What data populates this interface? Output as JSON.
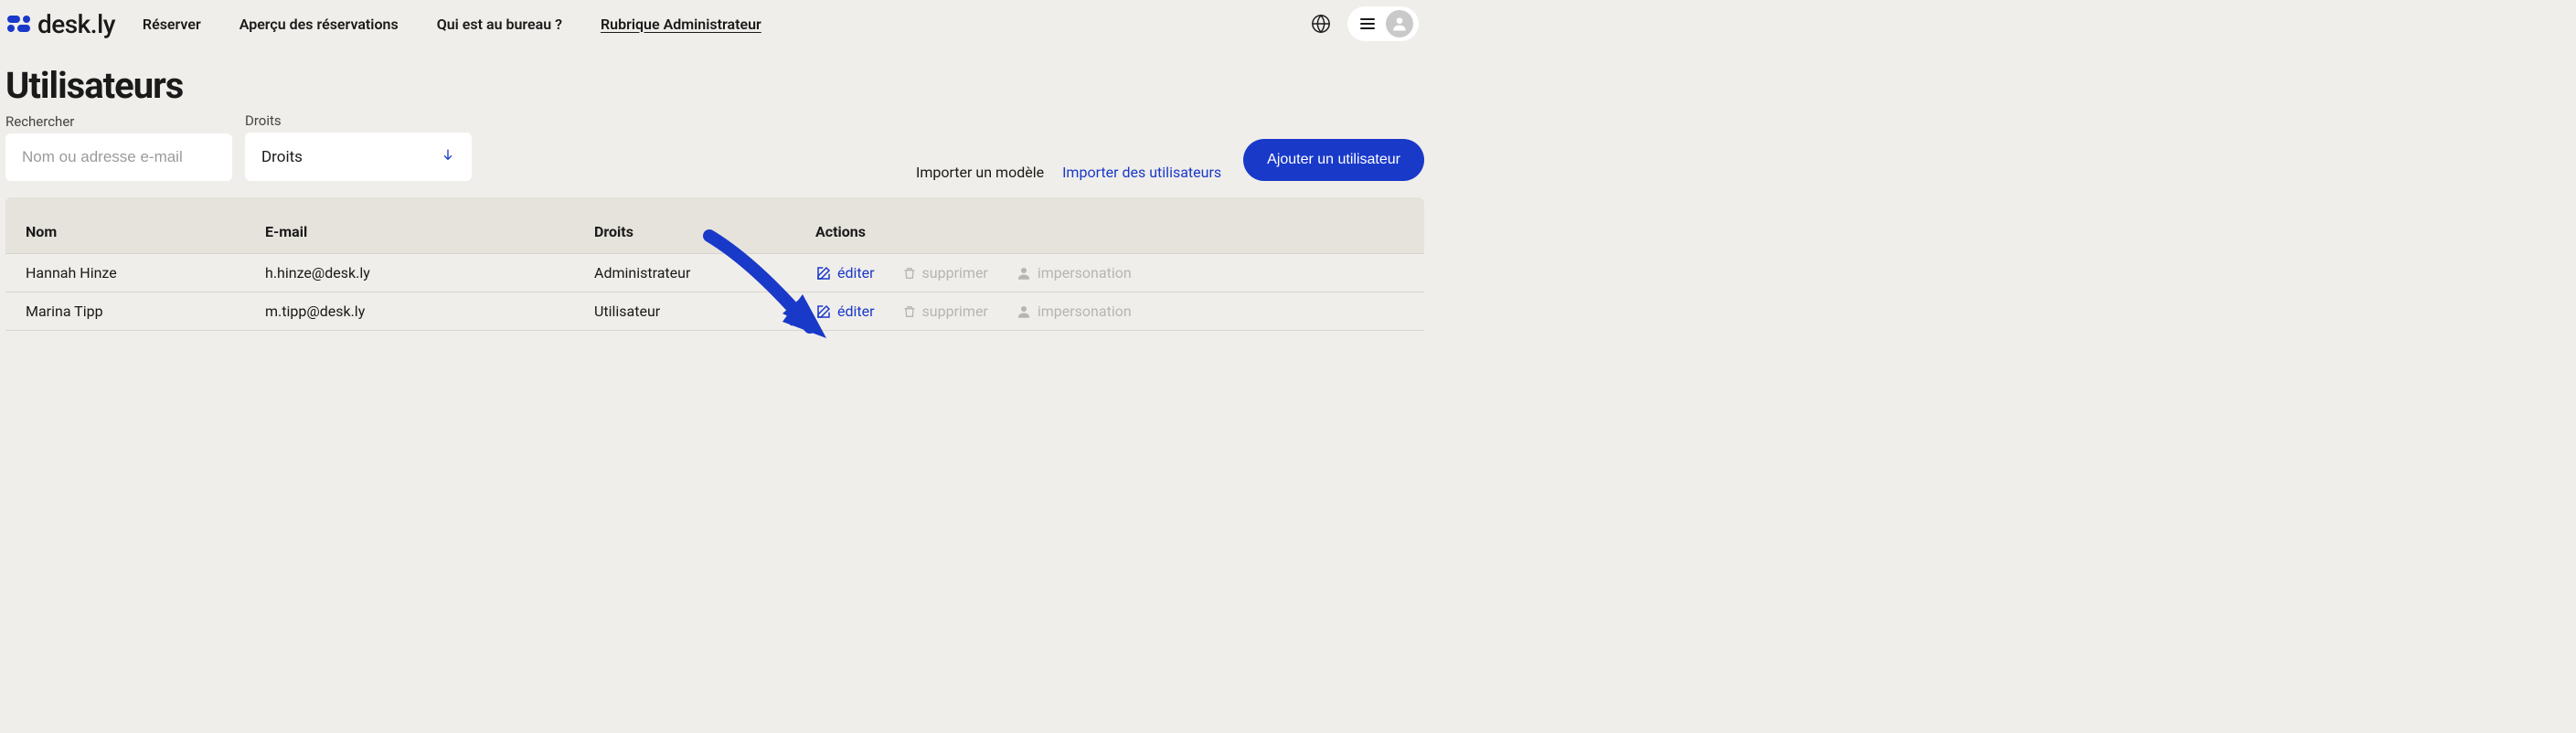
{
  "brand": {
    "name": "desk.ly"
  },
  "nav": {
    "items": [
      {
        "label": "Réserver",
        "active": false
      },
      {
        "label": "Aperçu des réservations",
        "active": false
      },
      {
        "label": "Qui est au bureau ?",
        "active": false
      },
      {
        "label": "Rubrique Administrateur",
        "active": true
      }
    ]
  },
  "page": {
    "title": "Utilisateurs"
  },
  "filters": {
    "search": {
      "label": "Rechercher",
      "placeholder": "Nom ou adresse e-mail"
    },
    "rights": {
      "label": "Droits",
      "selected": "Droits"
    }
  },
  "toolbar": {
    "import_template": "Importer un modèle",
    "import_users": "Importer des utilisateurs",
    "add_user": "Ajouter un utilisateur"
  },
  "table": {
    "headers": {
      "name": "Nom",
      "email": "E-mail",
      "rights": "Droits",
      "actions": "Actions"
    },
    "actions": {
      "edit": "éditer",
      "delete": "supprimer",
      "impersonate": "impersonation"
    },
    "rows": [
      {
        "name": "Hannah Hinze",
        "email": "h.hinze@desk.ly",
        "rights": "Administrateur"
      },
      {
        "name": "Marina Tipp",
        "email": "m.tipp@desk.ly",
        "rights": "Utilisateur"
      }
    ]
  },
  "icons": {
    "globe": "globe-icon",
    "menu": "hamburger-icon",
    "avatar": "person-icon",
    "arrow_down": "arrow-down-icon",
    "edit": "edit-icon",
    "trash": "trash-icon",
    "person": "person-icon"
  },
  "colors": {
    "accent": "#1939c9",
    "bg": "#f0eeea",
    "table_bg": "#e6e3dd",
    "muted": "#b7b5b0"
  }
}
